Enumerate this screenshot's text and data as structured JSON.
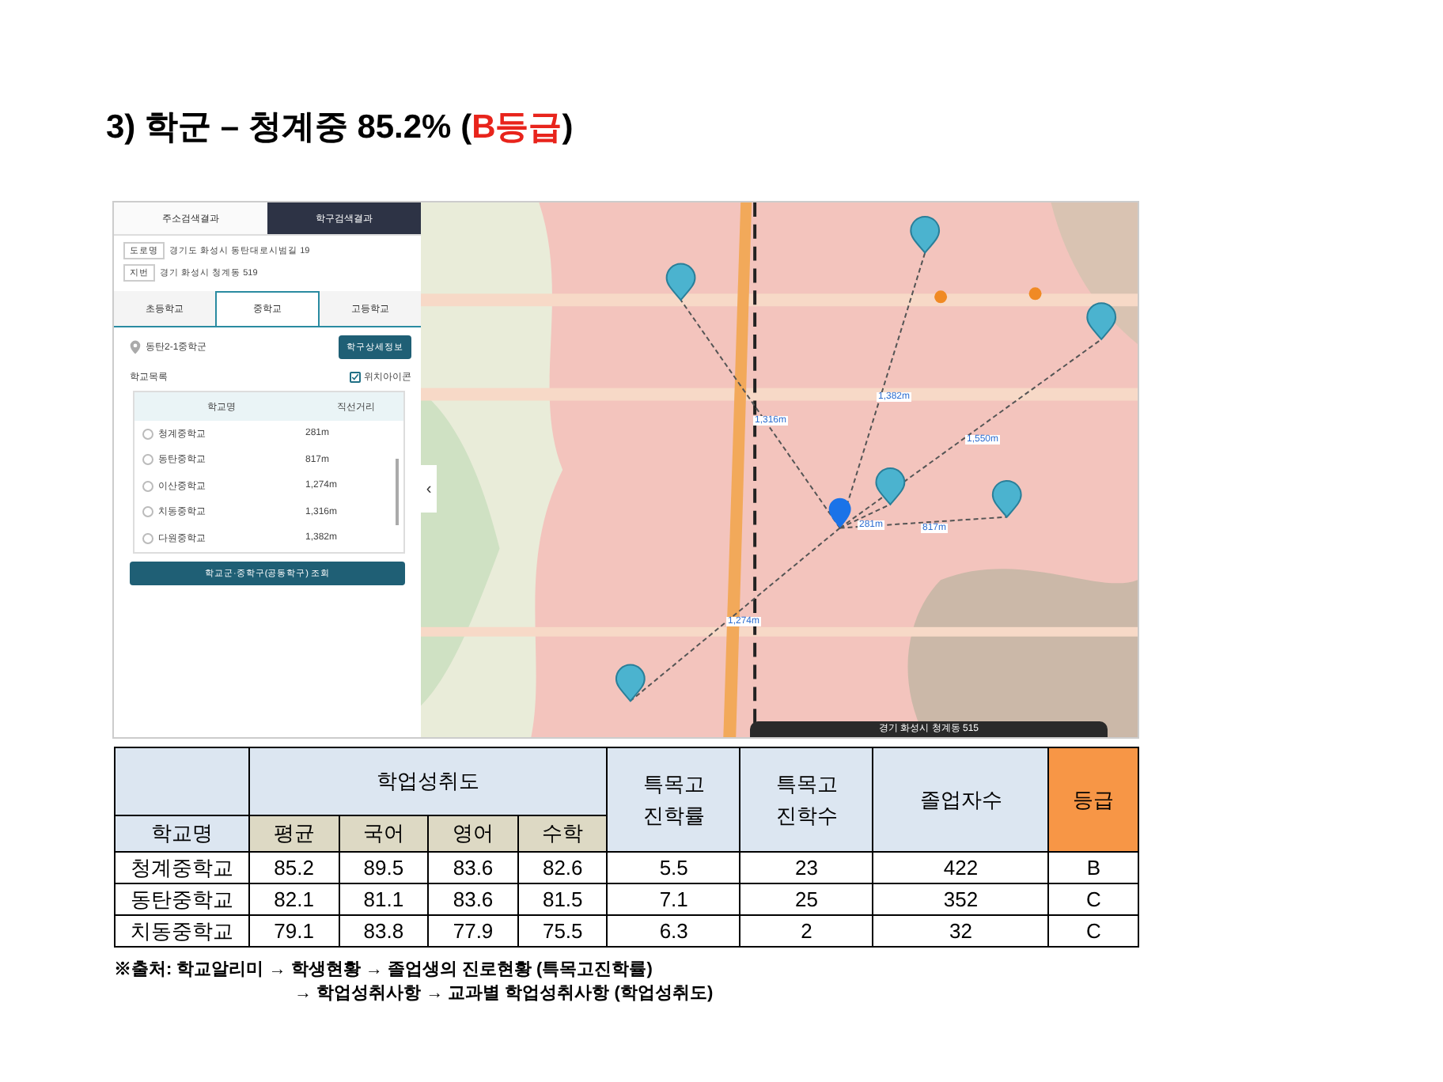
{
  "title": {
    "text": "3) 학군 – 청계중 85.2% (",
    "highlight": "B등급",
    "close": ")"
  },
  "screenshot": {
    "result_tabs": [
      {
        "label": "주소검색결과",
        "selected": false
      },
      {
        "label": "학구검색결과",
        "selected": true
      }
    ],
    "addresses": [
      {
        "tag": "도로명",
        "value": "경기도 화성시 동탄대로시범길 19"
      },
      {
        "tag": "지번",
        "value": "경기 화성시 청계동 519"
      }
    ],
    "level_tabs": [
      {
        "label": "초등학교",
        "selected": false
      },
      {
        "label": "중학교",
        "selected": true
      },
      {
        "label": "고등학교",
        "selected": false
      }
    ],
    "district": "동탄2-1중학군",
    "detail_button": "학구상세정보",
    "list_label": "학교목록",
    "icon_toggle": {
      "label": "위치아이콘",
      "checked": true
    },
    "list_columns": [
      "학교명",
      "직선거리"
    ],
    "schools": [
      {
        "name": "청계중학교",
        "distance": "281m",
        "selected": false
      },
      {
        "name": "동탄중학교",
        "distance": "817m",
        "selected": false
      },
      {
        "name": "이산중학교",
        "distance": "1,274m",
        "selected": false
      },
      {
        "name": "치동중학교",
        "distance": "1,316m",
        "selected": false
      },
      {
        "name": "다원중학교",
        "distance": "1,382m",
        "selected": false
      }
    ],
    "search_button": "학교군·중학구(공동학구) 조회",
    "collapse": "‹",
    "distance_labels": [
      "1,316m",
      "1,382m",
      "1,550m",
      "281m",
      "817m",
      "1,274m"
    ],
    "address_bar": "경기 화성시 청계동 515"
  },
  "table": {
    "school_header": "학교명",
    "group_header": "학업성취도",
    "sub_headers": [
      "평균",
      "국어",
      "영어",
      "수학"
    ],
    "other_headers": [
      "특목고\n진학률",
      "특목고\n진학수",
      "졸업자수"
    ],
    "grade_header": "등급",
    "rows": [
      [
        "청계중학교",
        "85.2",
        "89.5",
        "83.6",
        "82.6",
        "5.5",
        "23",
        "422",
        "B"
      ],
      [
        "동탄중학교",
        "82.1",
        "81.1",
        "83.6",
        "81.5",
        "7.1",
        "25",
        "352",
        "C"
      ],
      [
        "치동중학교",
        "79.1",
        "83.8",
        "77.9",
        "75.5",
        "6.3",
        "2",
        "32",
        "C"
      ]
    ]
  },
  "source": [
    "※출처: 학교알리미 → 학생현황 → 졸업생의 진로현황 (특목고진학률)",
    "→ 학업성취사항 → 교과별 학업성취사항 (학업성취도)"
  ]
}
